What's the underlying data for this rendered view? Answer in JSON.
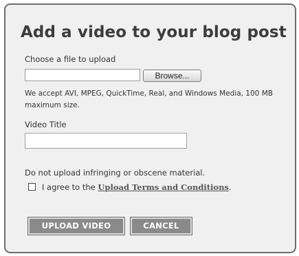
{
  "dialog": {
    "title": "Add a video to your blog post",
    "file_label": "Choose a file to upload",
    "file_value": "",
    "browse_label": "Browse...",
    "hint": "We accept AVI, MPEG, QuickTime, Real, and Windows Media, 100 MB maximum size.",
    "video_title_label": "Video Title",
    "video_title_value": "",
    "warning": "Do not upload infringing or obscene material.",
    "agree_prefix": "I agree to the ",
    "terms_link": "Upload Terms and Conditions",
    "agree_suffix": ".",
    "agree_checked": false,
    "upload_button": "UPLOAD VIDEO",
    "cancel_button": "CANCEL"
  },
  "colors": {
    "panel_background": "#f0f0f0",
    "panel_border": "#6d6d6d",
    "button_background": "#8a8a8a",
    "button_text": "#ffffff"
  }
}
